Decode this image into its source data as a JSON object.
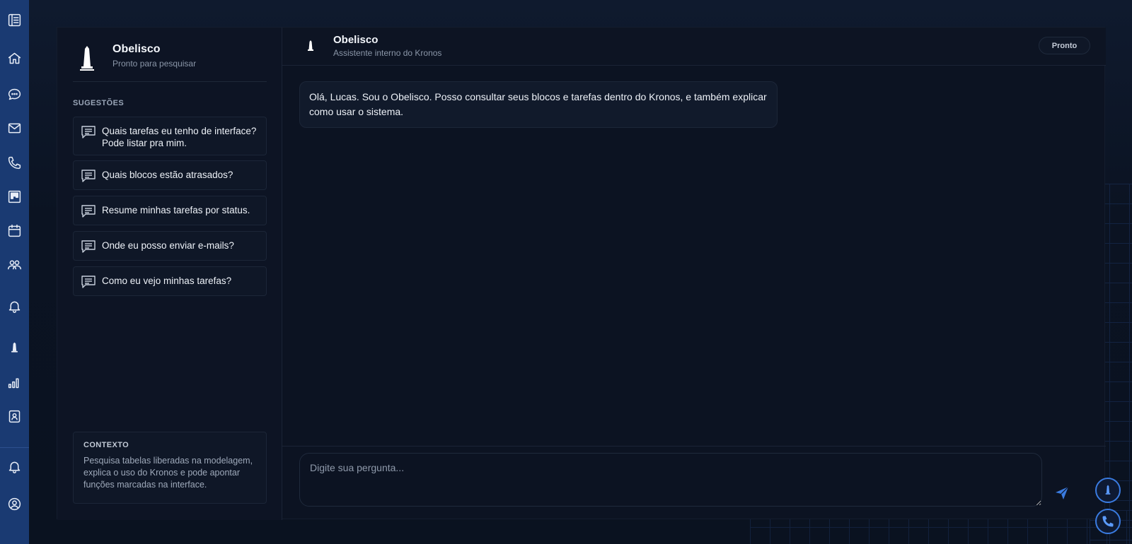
{
  "rail": {
    "items": [
      {
        "icon": "document-list-icon"
      },
      {
        "icon": "home-icon"
      },
      {
        "icon": "chat-bubble-icon"
      },
      {
        "icon": "mail-icon"
      },
      {
        "icon": "phone-icon"
      },
      {
        "icon": "kanban-icon"
      },
      {
        "icon": "calendar-icon"
      },
      {
        "icon": "team-icon"
      },
      {
        "icon": "bell-icon"
      },
      {
        "icon": "obelisk-icon"
      },
      {
        "icon": "bar-chart-icon"
      },
      {
        "icon": "contact-card-icon"
      },
      {
        "icon": "notification-bell-icon"
      },
      {
        "icon": "user-profile-icon"
      }
    ]
  },
  "sidebar": {
    "title": "Obelisco",
    "subtitle": "Pronto para pesquisar",
    "suggestions_heading": "SUGESTÕES",
    "suggestions": [
      {
        "label": "Quais tarefas eu tenho de interface? Pode listar pra mim."
      },
      {
        "label": "Quais blocos estão atrasados?"
      },
      {
        "label": "Resume minhas tarefas por status."
      },
      {
        "label": "Onde eu posso enviar e-mails?"
      },
      {
        "label": "Como eu vejo minhas tarefas?"
      }
    ],
    "context": {
      "heading": "CONTEXTO",
      "body": "Pesquisa tabelas liberadas na modelagem, explica o uso do Kronos e pode apontar funções marcadas na interface."
    }
  },
  "chat": {
    "title": "Obelisco",
    "subtitle": "Assistente interno do Kronos",
    "status": "Pronto",
    "messages": [
      {
        "role": "assistant",
        "text": "Olá, Lucas. Sou o Obelisco. Posso consultar seus blocos e tarefas dentro do Kronos, e também explicar como usar o sistema."
      }
    ],
    "input": {
      "placeholder": "Digite sua pergunta...",
      "value": ""
    }
  },
  "colors": {
    "rail": "#1a3a72",
    "panel": "#0c1322",
    "accent": "#3a7be0"
  }
}
